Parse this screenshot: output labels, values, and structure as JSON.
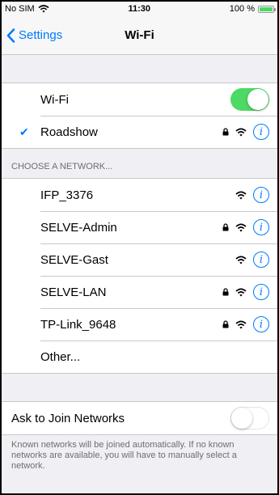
{
  "status_bar": {
    "carrier": "No SIM",
    "time": "11:30",
    "battery": "100 %"
  },
  "nav": {
    "back_label": "Settings",
    "title": "Wi-Fi"
  },
  "wifi": {
    "label": "Wi-Fi",
    "enabled": true
  },
  "connected": {
    "name": "Roadshow",
    "locked": true
  },
  "networks_header": "CHOOSE A NETWORK...",
  "networks": [
    {
      "name": "IFP_3376",
      "locked": false
    },
    {
      "name": "SELVE-Admin",
      "locked": true
    },
    {
      "name": "SELVE-Gast",
      "locked": false
    },
    {
      "name": "SELVE-LAN",
      "locked": true
    },
    {
      "name": "TP-Link_9648",
      "locked": true
    }
  ],
  "other_label": "Other...",
  "ask_join": {
    "label": "Ask to Join Networks",
    "enabled": false
  },
  "footer": "Known networks will be joined automatically. If no known networks are available, you will have to manually select a network.",
  "colors": {
    "accent": "#007aff",
    "toggle_on": "#4cd964",
    "background": "#efeff4"
  }
}
